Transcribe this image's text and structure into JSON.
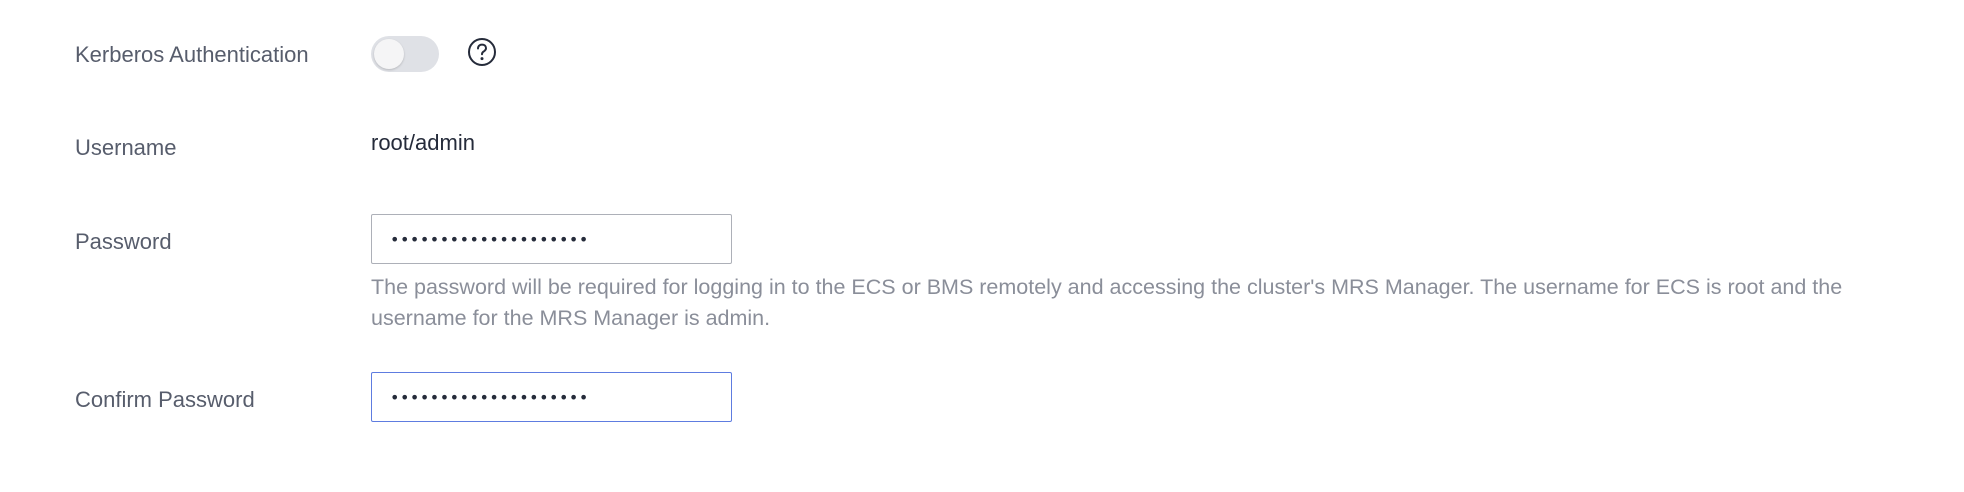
{
  "form": {
    "kerberos": {
      "label": "Kerberos Authentication",
      "enabled": false,
      "help_icon": "question-circle-icon"
    },
    "username": {
      "label": "Username",
      "value": "root/admin"
    },
    "password": {
      "label": "Password",
      "value": "••••••••••••••••••••",
      "hint": "The password will be required for logging in to the ECS or BMS remotely and accessing the cluster's MRS Manager. The username for ECS is root and the username for the MRS Manager is admin."
    },
    "confirm_password": {
      "label": "Confirm Password",
      "value": "••••••••••••••••••••"
    }
  },
  "colors": {
    "label": "#575d6c",
    "value": "#252b3a",
    "hint": "#8a8e99",
    "input_border": "#adb0b8",
    "input_focus_border": "#5e7ce0",
    "toggle_off": "#dfe1e6"
  }
}
